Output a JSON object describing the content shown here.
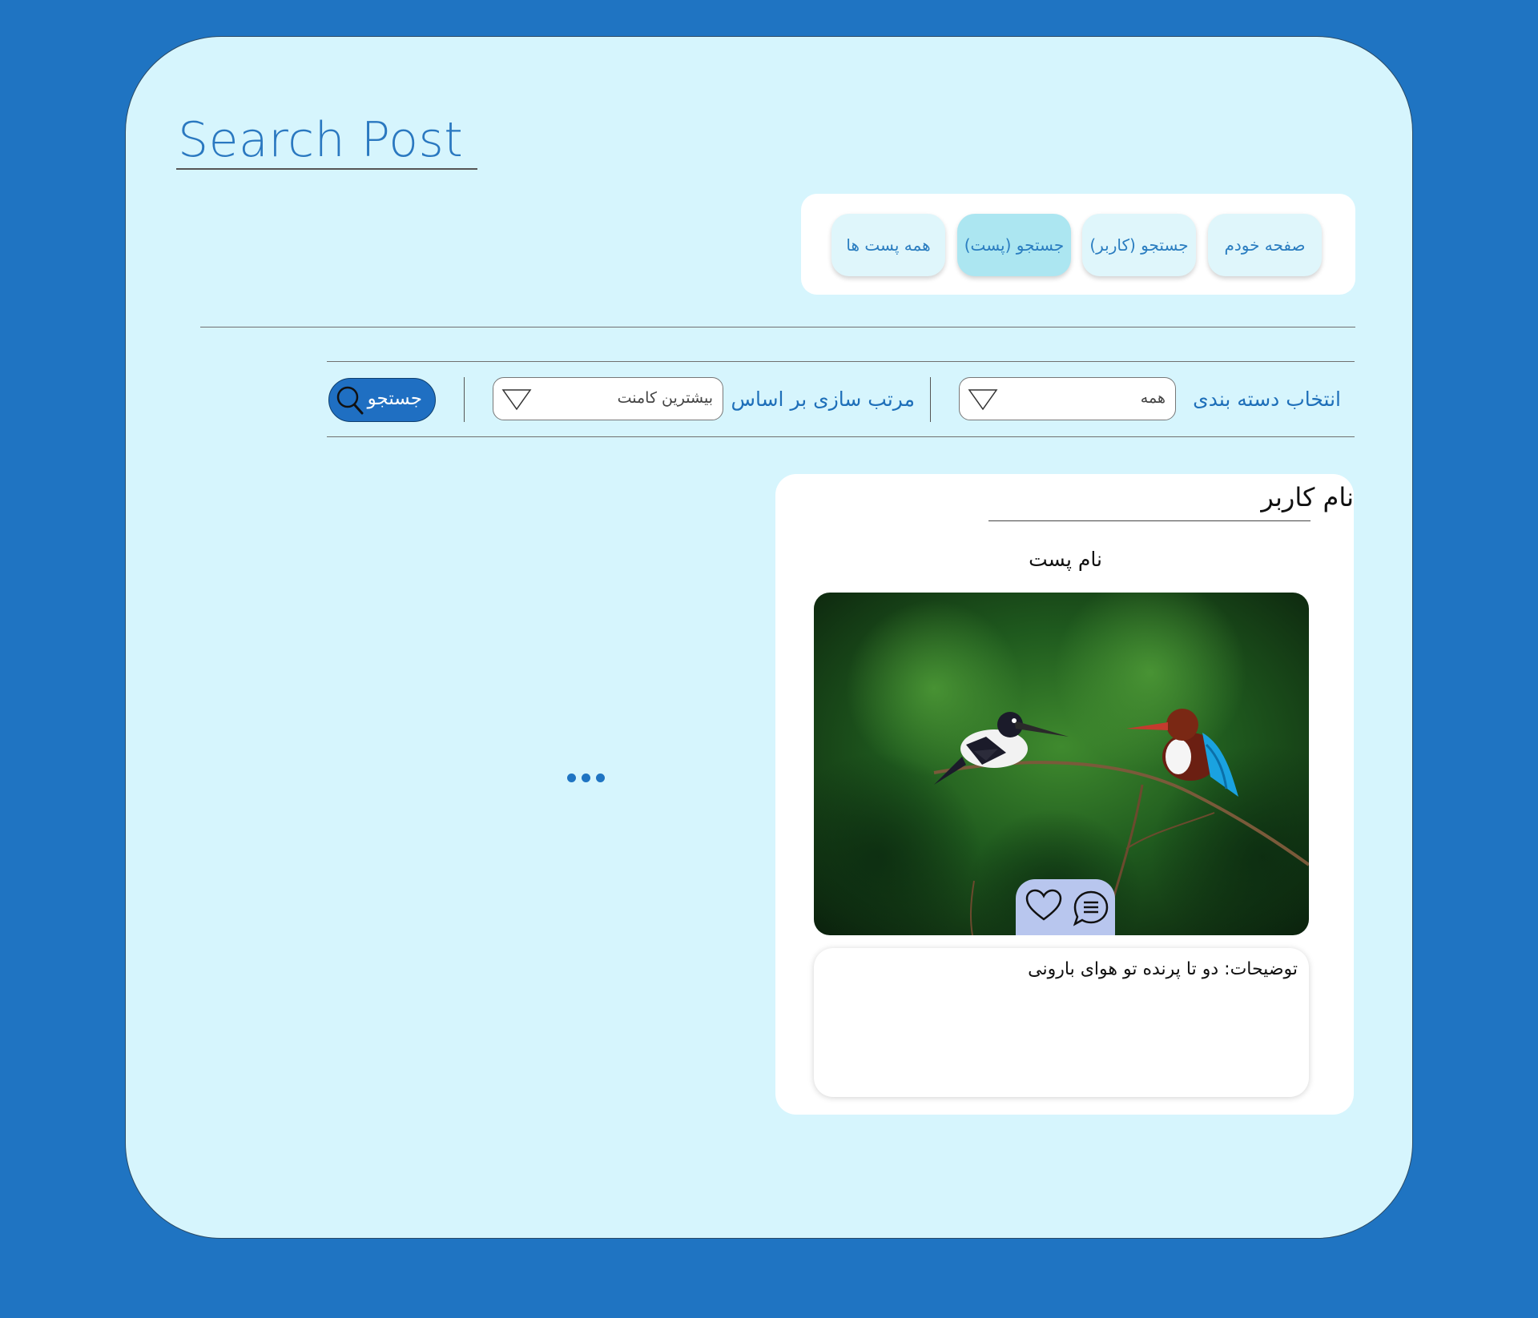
{
  "page": {
    "title": "Search Post"
  },
  "nav": {
    "items": [
      {
        "label": "صفحه خودم"
      },
      {
        "label": "جستجو (کاربر)"
      },
      {
        "label": "جستجو (پست)",
        "active": true
      },
      {
        "label": "همه پست ها"
      }
    ]
  },
  "filters": {
    "category_label": "انتخاب دسته بندی",
    "category_value": "همه",
    "sort_label": "مرتب سازی بر اساس",
    "sort_value": "بیشترین کامنت",
    "search_label": "جستجو"
  },
  "post": {
    "username": "نام کاربر",
    "post_name": "نام پست",
    "description": "توضیحات: دو تا پرنده تو هوای بارونی",
    "image_subject": "two kingfishers on a branch"
  },
  "colors": {
    "background": "#1f74c2",
    "panel": "#d6f5fd",
    "accent": "#2a7dc0",
    "active_tab": "#ace6f1",
    "action_pill": "#b8c6ee"
  },
  "icons": [
    "search-icon",
    "dropdown-triangle-icon",
    "heart-icon",
    "comment-icon",
    "more-dots-icon"
  ]
}
